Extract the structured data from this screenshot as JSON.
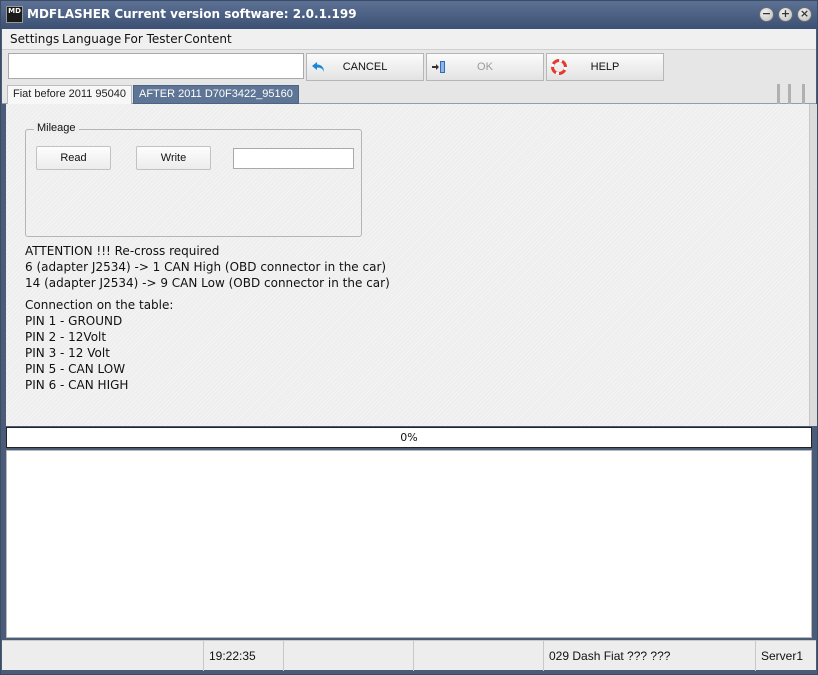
{
  "window": {
    "title": "MDFLASHER  Current version software: 2.0.1.199",
    "icon_label": "MD"
  },
  "menu": [
    "Settings",
    "Language",
    "For Tester",
    "Content"
  ],
  "toolbar": {
    "input_value": "",
    "cancel_label": "CANCEL",
    "ok_label": "OK",
    "help_label": "HELP",
    "icons": {
      "cancel": "undo-arrow-icon",
      "ok": "door-exit-icon",
      "help": "lifebuoy-icon"
    },
    "colors": {
      "cancel_icon": "#1c86d6",
      "help_icon": "#e23b2e"
    }
  },
  "tabs": [
    {
      "label": "Fiat before 2011 95040",
      "active": false
    },
    {
      "label": "AFTER 2011 D70F3422_95160",
      "active": true
    }
  ],
  "mileage": {
    "title": "Mileage",
    "read_label": "Read",
    "write_label": "Write",
    "value": ""
  },
  "attention": [
    "ATTENTION !!! Re-cross required",
    "6 (adapter J2534) -> 1 CAN High (OBD connector in the car)",
    "14 (adapter J2534) -> 9 CAN Low (OBD connector in the car)"
  ],
  "connection": [
    "Connection on the table:",
    "PIN 1 - GROUND",
    "PIN 2 - 12Volt",
    "PIN 3 - 12 Volt",
    "PIN 5 - CAN LOW",
    "PIN 6 - CAN HIGH"
  ],
  "progress": {
    "percent": 0,
    "label": "0%"
  },
  "status": {
    "time": "19:22:35",
    "device": "029 Dash Fiat ??? ???",
    "server": "Server1"
  },
  "colors": {
    "titlebar": "#4a5e80",
    "active_tab": "#5e7596"
  }
}
